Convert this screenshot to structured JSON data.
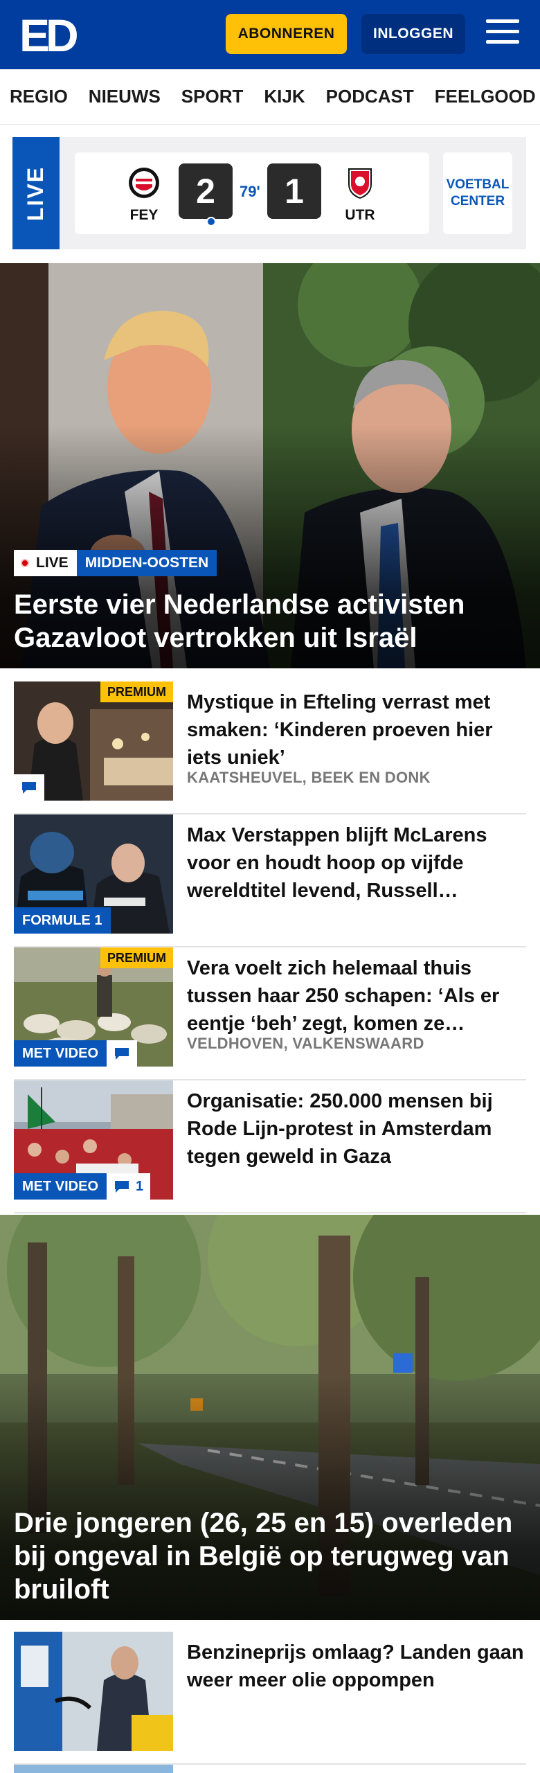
{
  "header": {
    "logo": "ED",
    "subscribe_label": "ABONNEREN",
    "login_label": "INLOGGEN"
  },
  "nav": {
    "items": [
      "REGIO",
      "NIEUWS",
      "SPORT",
      "KIJK",
      "PODCAST",
      "FEELGOOD"
    ]
  },
  "live": {
    "tag": "LIVE",
    "home": "FEY",
    "away": "UTR",
    "home_score": "2",
    "away_score": "1",
    "minute": "79'",
    "voetbal_center": "VOETBAL CENTER"
  },
  "hero1": {
    "live_tag": "LIVE",
    "category": "MIDDEN-OOSTEN",
    "title": "Eerste vier Nederlandse activisten Gazavloot vertrokken uit Israël"
  },
  "articles": [
    {
      "title": "Mystique in Efteling verrast met smaken: ‘Kinderen proeven hier iets uniek’",
      "subtitle": "KAATSHEUVEL, BEEK EN DONK",
      "premium": "PREMIUM"
    },
    {
      "title": "Max Verstappen blijft McLarens voor en houdt hoop op vijfde wereldtitel levend, Russell…",
      "tag": "FORMULE 1"
    },
    {
      "title": "Vera voelt zich helemaal thuis tussen haar 250 schapen: ‘Als er eentje ‘beh’ zegt, komen ze…",
      "subtitle": "VELDHOVEN, VALKENSWAARD",
      "premium": "PREMIUM",
      "tag": "MET VIDEO"
    },
    {
      "title": "Organisatie: 250.000 mensen bij Rode Lijn-protest in Amsterdam tegen geweld in Gaza",
      "tag": "MET VIDEO",
      "comments": "1"
    }
  ],
  "hero2": {
    "title": "Drie jongeren (26, 25 en 15) overleden bij ongeval in België op terugweg van bruiloft"
  },
  "article5": {
    "title": "Benzineprijs omlaag? Landen gaan weer meer olie oppompen"
  },
  "colors": {
    "brand_blue": "#003d9e",
    "accent_blue": "#0a56b8",
    "subscribe_yellow": "#ffc107"
  }
}
